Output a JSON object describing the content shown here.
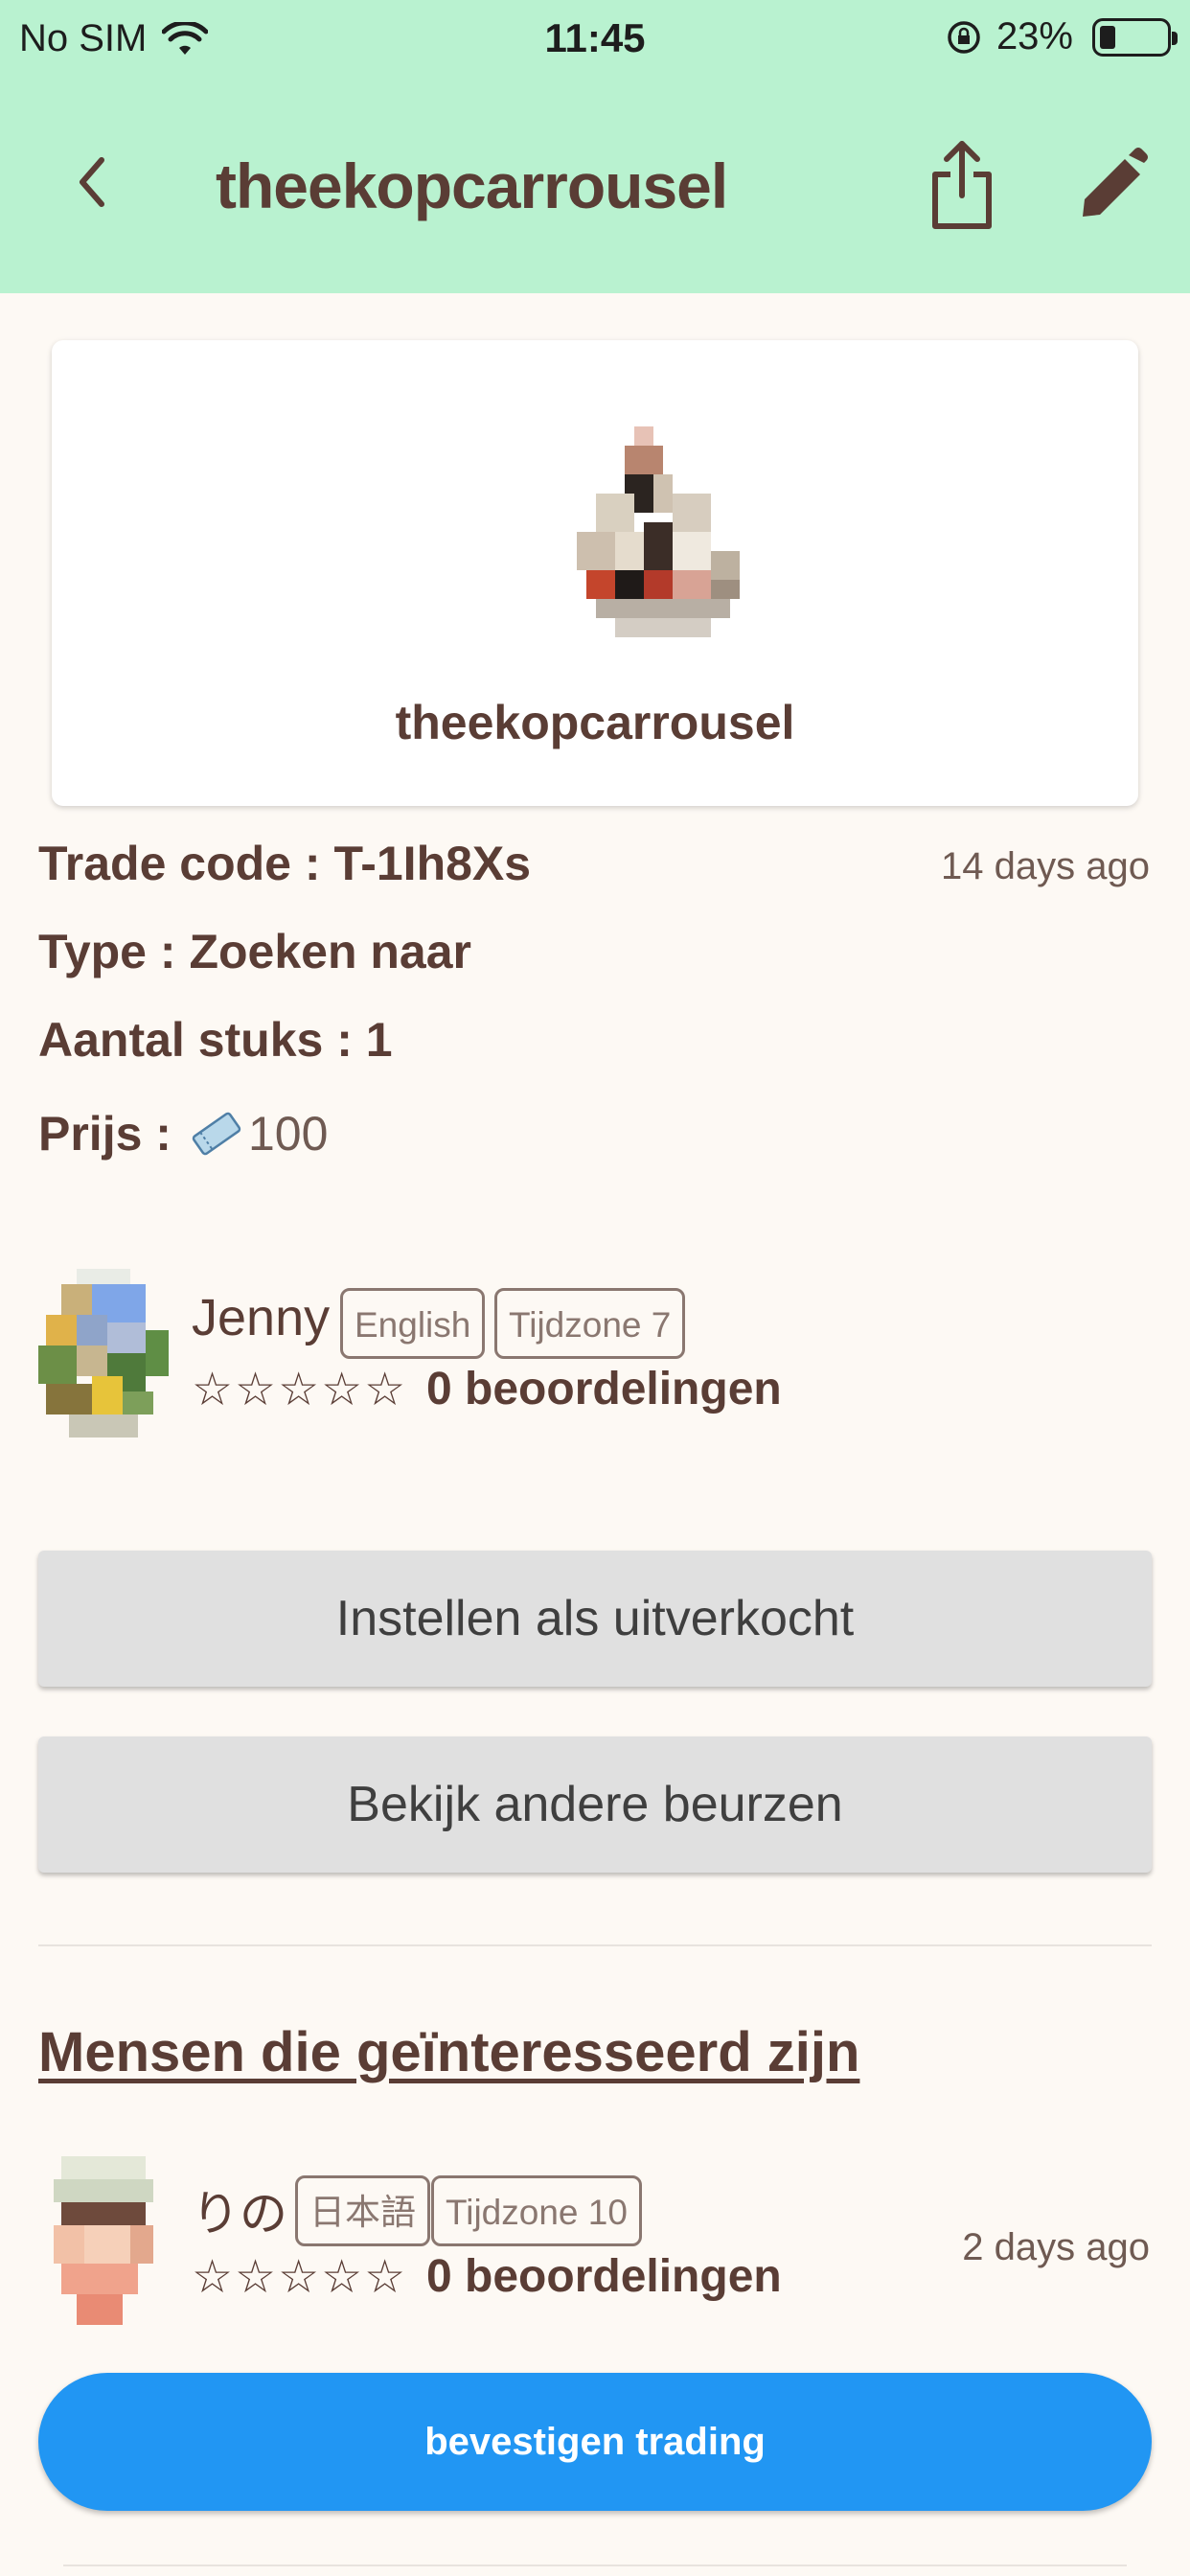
{
  "status_bar": {
    "carrier": "No SIM",
    "time": "11:45",
    "battery": "23%"
  },
  "header": {
    "title": "theekopcarrousel"
  },
  "item": {
    "name": "theekopcarrousel"
  },
  "details": {
    "trade_code_label": "Trade code :",
    "trade_code": "T-1Ih8Xs",
    "posted_ago": "14 days ago",
    "type_label": "Type :",
    "type": "Zoeken naar",
    "quantity_label": "Aantal stuks :",
    "quantity": "1",
    "price_label": "Prijs :",
    "price": "100"
  },
  "owner": {
    "name": "Jenny",
    "language": "English",
    "timezone": "Tijdzone 7",
    "stars": "☆☆☆☆☆",
    "reviews": "0 beoordelingen"
  },
  "buttons": {
    "sold_out": "Instellen als uitverkocht",
    "other_markets": "Bekijk andere beurzen",
    "confirm_trading": "bevestigen trading"
  },
  "interested": {
    "title": "Mensen die geïnteresseerd zijn",
    "users": [
      {
        "name": "りの",
        "language": "日本語",
        "timezone": "Tijdzone 10",
        "stars": "☆☆☆☆☆",
        "reviews": "0 beoordelingen",
        "ago": "2 days ago"
      }
    ]
  },
  "colors": {
    "header_bg": "#b9f2d0",
    "page_bg": "#fdf9f4",
    "text": "#5a3d35",
    "confirm": "#2196f3"
  }
}
